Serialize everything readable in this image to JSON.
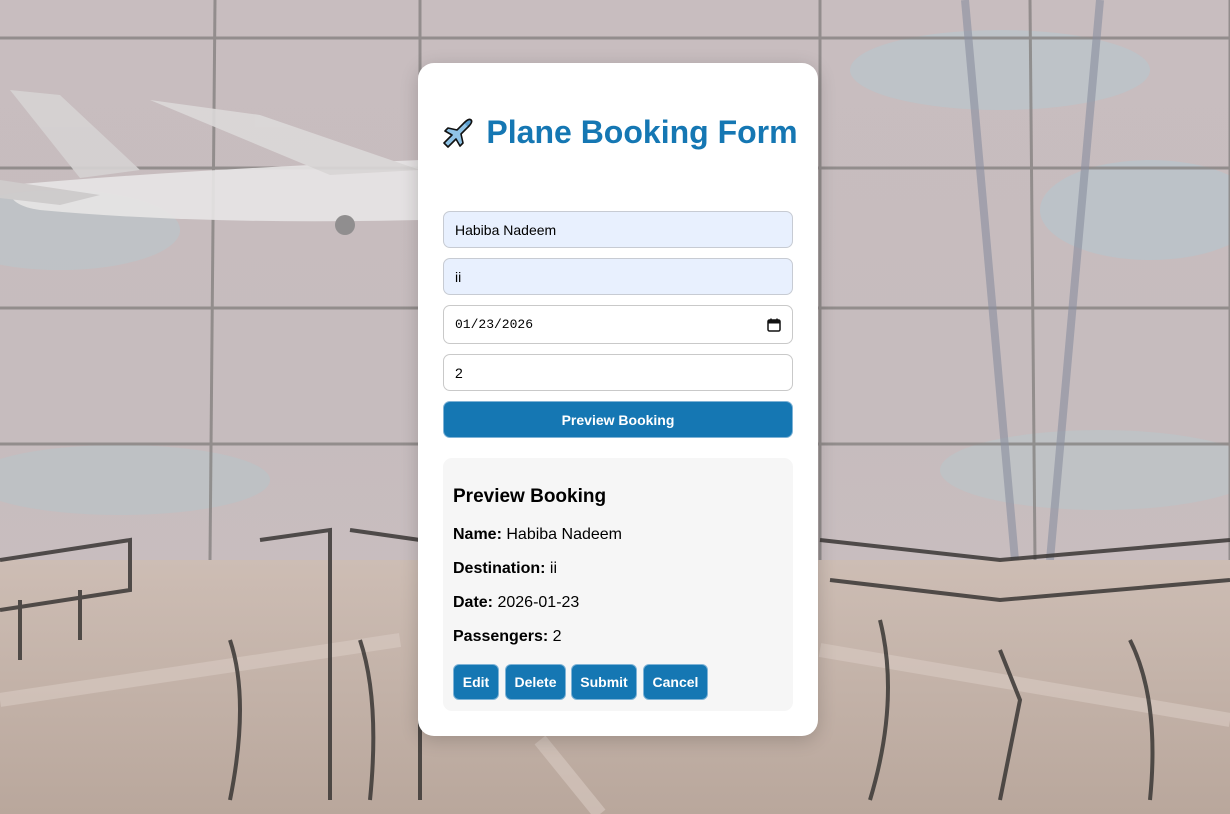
{
  "form": {
    "title": "Plane Booking Form",
    "title_icon": "airplane-icon",
    "name_value": "Habiba Nadeem",
    "destination_value": "ii",
    "date_value": "01/23/2026",
    "passengers_value": "2",
    "preview_button_label": "Preview Booking"
  },
  "preview": {
    "heading": "Preview Booking",
    "name_label": "Name:",
    "name_value": "Habiba Nadeem",
    "destination_label": "Destination:",
    "destination_value": "ii",
    "date_label": "Date:",
    "date_value": "2026-01-23",
    "passengers_label": "Passengers:",
    "passengers_value": "2",
    "buttons": {
      "edit": "Edit",
      "delete": "Delete",
      "submit": "Submit",
      "cancel": "Cancel"
    }
  },
  "colors": {
    "accent": "#1577b3",
    "autofill_bg": "#e8f0fe",
    "preview_bg": "#f6f6f6"
  }
}
